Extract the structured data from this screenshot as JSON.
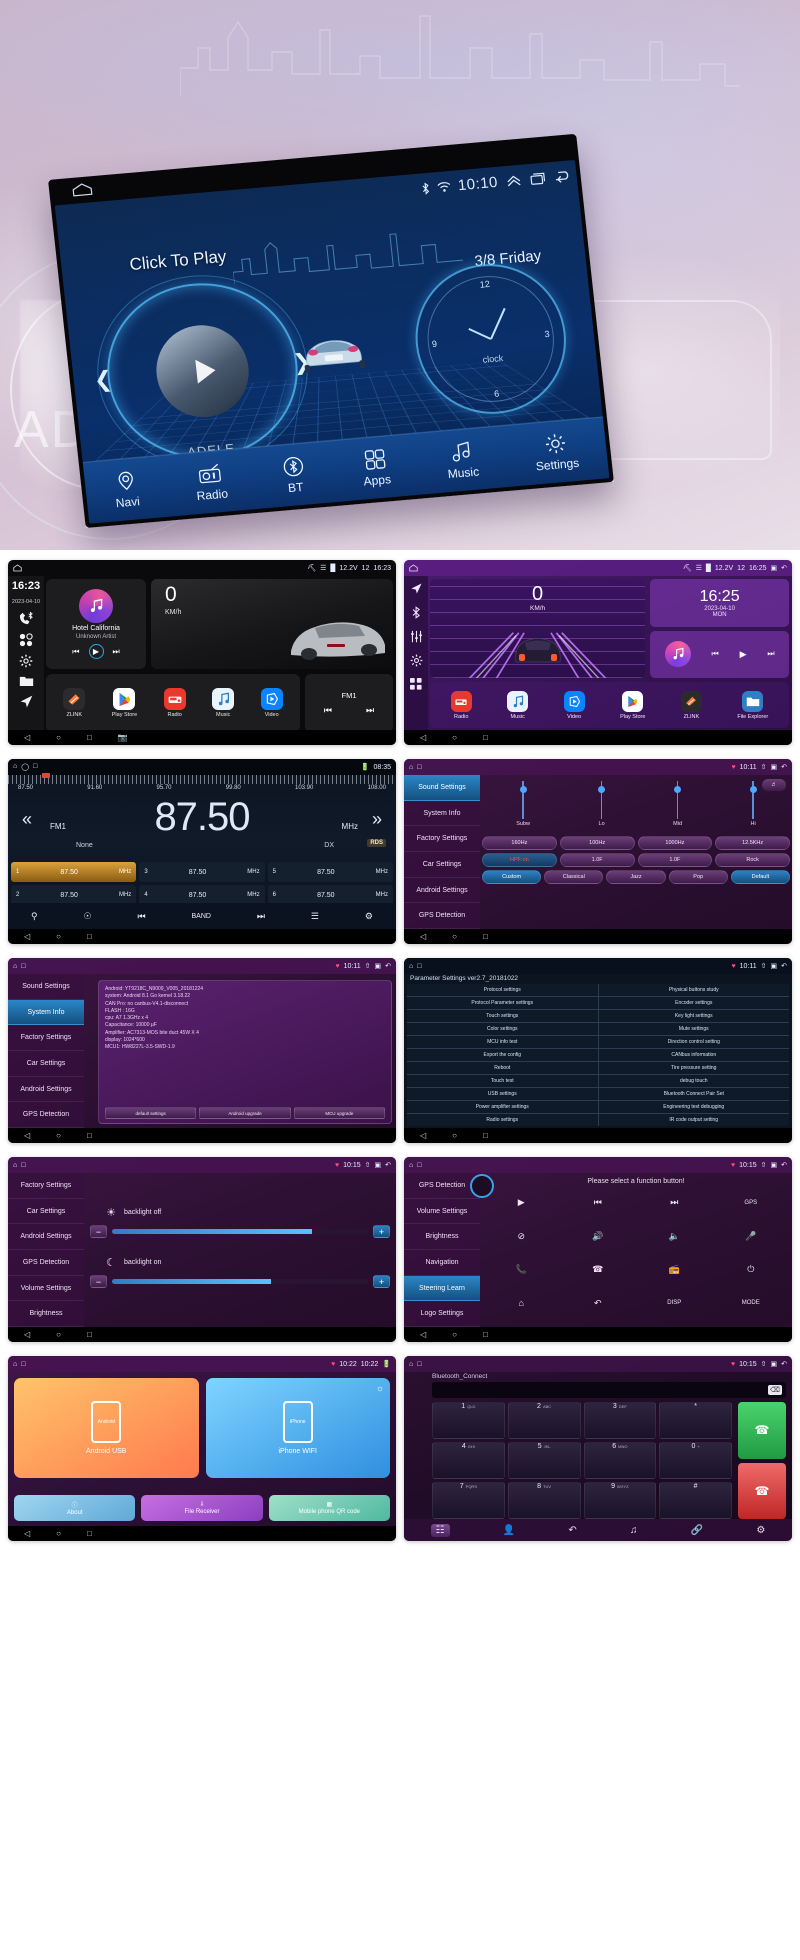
{
  "hero": {
    "status": {
      "time": "10:10",
      "bluetooth_icon": "bluetooth-icon",
      "wifi_icon": "wifi-icon"
    },
    "click_to_play": "Click To Play",
    "date": "3/8 Friday",
    "album_label": "ADELE",
    "clock_word": "clock",
    "clock_numbers": [
      "12",
      "3",
      "6",
      "9"
    ],
    "nav": [
      {
        "label": "Navi",
        "icon": "location-pin-icon"
      },
      {
        "label": "Radio",
        "icon": "radio-icon"
      },
      {
        "label": "BT",
        "icon": "bluetooth-circle-icon"
      },
      {
        "label": "Apps",
        "icon": "apps-grid-icon"
      },
      {
        "label": "Music",
        "icon": "music-note-icon"
      },
      {
        "label": "Settings",
        "icon": "gear-icon"
      }
    ]
  },
  "shot1": {
    "name": "black-home-screen",
    "status": {
      "home_icon": "home-icon",
      "bluetooth": "bluetooth-icon",
      "wifi": "wifi-icon",
      "signal": "signal-icon",
      "battery_volt": "12.2V",
      "volume": "12",
      "time": "16:23"
    },
    "sidebar": {
      "time": "16:23",
      "date": "2023-04-10",
      "icons": [
        "bluetooth-phone-icon",
        "apps-grid-icon",
        "gear-icon",
        "folder-icon",
        "navigation-arrow-icon"
      ]
    },
    "music": {
      "title": "Hotel California",
      "artist": "Unknown Artist",
      "prev": "prev-icon",
      "play": "play-icon",
      "next": "next-icon"
    },
    "speed": {
      "value": "0",
      "unit": "KM/h"
    },
    "apps": [
      {
        "label": "ZLINK",
        "icon": "zlink-icon",
        "color": "#2b2b2e"
      },
      {
        "label": "Play Store",
        "icon": "play-store-icon",
        "color": "#ffffff"
      },
      {
        "label": "Radio",
        "icon": "radio-icon",
        "color": "#e8392c"
      },
      {
        "label": "Music",
        "icon": "music-note-icon",
        "color": "#eaf4ff"
      },
      {
        "label": "Video",
        "icon": "video-icon",
        "color": "#0a84ff"
      }
    ],
    "fm": {
      "label": "FM1",
      "prev": "prev-icon",
      "next": "next-icon"
    },
    "navbar": [
      "back-icon",
      "home-icon",
      "recents-icon",
      "screenshot-icon"
    ]
  },
  "shot2": {
    "name": "purple-home-screen",
    "status": {
      "home_icon": "home-icon",
      "bluetooth": "bluetooth-icon",
      "wifi": "wifi-icon",
      "signal": "signal-icon",
      "battery_volt": "12.2V",
      "volume": "12",
      "time": "16:25"
    },
    "sidebar": [
      "navigation-arrow-icon",
      "bluetooth-icon",
      "equalizer-icon",
      "gear-icon",
      "apps-grid-icon"
    ],
    "speed": {
      "value": "0",
      "unit": "KM/h"
    },
    "clock": {
      "time": "16:25",
      "date": "2023-04-10",
      "day": "MON"
    },
    "music_controls": {
      "prev": "prev-icon",
      "play": "play-icon",
      "next": "next-icon"
    },
    "apps": [
      {
        "label": "Radio",
        "icon": "radio-icon",
        "color": "#e8392c"
      },
      {
        "label": "Music",
        "icon": "music-note-icon",
        "color": "#eaf4ff"
      },
      {
        "label": "Video",
        "icon": "video-icon",
        "color": "#0a84ff"
      },
      {
        "label": "Play Store",
        "icon": "play-store-icon",
        "color": "#ffffff"
      },
      {
        "label": "ZLINK",
        "icon": "zlink-icon",
        "color": "#2b2b2e"
      },
      {
        "label": "File Explorer",
        "icon": "folder-icon",
        "color": "#2f7fc4"
      }
    ]
  },
  "shot3": {
    "name": "fm-radio-screen",
    "status": {
      "time": "08:35",
      "battery": "battery-icon"
    },
    "scale_ticks": [
      "87.50",
      "91.60",
      "95.70",
      "99.80",
      "103.90",
      "108.00"
    ],
    "frequency": "87.50",
    "band": "FM1",
    "unit": "MHz",
    "station_name": "None",
    "mode": "DX",
    "rds": "RDS",
    "prev_icon": "double-chevron-left-icon",
    "next_icon": "double-chevron-right-icon",
    "presets": [
      {
        "n": "1",
        "freq": "87.50",
        "unit": "MHz",
        "active": true
      },
      {
        "n": "3",
        "freq": "87.50",
        "unit": "MHz",
        "active": false
      },
      {
        "n": "5",
        "freq": "87.50",
        "unit": "MHz",
        "active": false
      },
      {
        "n": "2",
        "freq": "87.50",
        "unit": "MHz",
        "active": false
      },
      {
        "n": "4",
        "freq": "87.50",
        "unit": "MHz",
        "active": false
      },
      {
        "n": "6",
        "freq": "87.50",
        "unit": "MHz",
        "active": false
      }
    ],
    "bottom_icons": [
      "search-icon",
      "scan-icon",
      "prev-icon",
      "band-label",
      "next-icon",
      "equalizer-icon",
      "gear-icon"
    ],
    "band_label": "BAND"
  },
  "shot4": {
    "name": "sound-settings-screen",
    "status": {
      "time": "10:11"
    },
    "menu": [
      {
        "label": "Sound Settings",
        "selected": true
      },
      {
        "label": "System Info",
        "selected": false
      },
      {
        "label": "Factory Settings",
        "selected": false
      },
      {
        "label": "Car Settings",
        "selected": false
      },
      {
        "label": "Android Settings",
        "selected": false
      },
      {
        "label": "GPS Detection",
        "selected": false
      }
    ],
    "sliders": [
      {
        "label": "Subw",
        "pos": 12
      },
      {
        "label": "Lo",
        "pos": 12
      },
      {
        "label": "Mid",
        "pos": 12
      },
      {
        "label": "Hi",
        "pos": 12
      }
    ],
    "freq_row": [
      "160Hz",
      "100Hz",
      "1000Hz",
      "12.5KHz"
    ],
    "gain_row": [
      "HPF:on",
      "1.0F",
      "1.0F",
      "Rock"
    ],
    "preset_row": [
      "Custom",
      "Classical",
      "Jazz",
      "Pop",
      "Default"
    ],
    "eq_icon": "equalizer-icon"
  },
  "shot5": {
    "name": "system-info-screen",
    "status": {
      "time": "10:11"
    },
    "menu": [
      {
        "label": "Sound Settings",
        "selected": false
      },
      {
        "label": "System Info",
        "selected": true
      },
      {
        "label": "Factory Settings",
        "selected": false
      },
      {
        "label": "Car Settings",
        "selected": false
      },
      {
        "label": "Android Settings",
        "selected": false
      },
      {
        "label": "GPS Detection",
        "selected": false
      }
    ],
    "lines": [
      "Android: YT9218C_N9009_V005_20181224",
      "system: Android 8.1 Go   kernel 3.18.22",
      "CAN Pro:  no canbus-V4.1-disconnect",
      "FLASH : 16G",
      "cpu: A7 1.3GHz x 4",
      "Capacitance: 10000 µF",
      "Amplifier:  AC7313-MOS bite duct 45W X 4",
      "display:  1024*600",
      "MCU1: HW8227L-3.5-SWD-1.9"
    ],
    "buttons": [
      "default settings",
      "Android upgrade",
      "MCU upgrade"
    ]
  },
  "shot6": {
    "name": "parameter-settings-screen",
    "title": "Parameter Settings ver2.7_20181022",
    "status": {
      "time": "10:11"
    },
    "cells": [
      "Protocol settings",
      "Physical buttons study",
      "Protocol Parameter settings",
      "Encoder settings",
      "Touch settings",
      "Key light settings",
      "Color settings",
      "Mute settings",
      "MCU info test",
      "Direction control setting",
      "Export the config",
      "CANbus information",
      "Reboot",
      "Tire pressure setting",
      "Touch test",
      "debug touch",
      "USB settings",
      "Bluetooth Connect Pair Set",
      "Power amplifier settings",
      "Engineering test debugging",
      "Radio settings",
      "IR code output setting"
    ]
  },
  "shot7": {
    "name": "backlight-settings-screen",
    "status": {
      "time": "10:15"
    },
    "menu": [
      {
        "label": "Factory Settings",
        "selected": false
      },
      {
        "label": "Car Settings",
        "selected": false
      },
      {
        "label": "Android Settings",
        "selected": false
      },
      {
        "label": "GPS Detection",
        "selected": false
      },
      {
        "label": "Volume Settings",
        "selected": false
      },
      {
        "label": "Brightness",
        "selected": true
      }
    ],
    "rows": [
      {
        "icon": "sun-icon",
        "label": "backlight off",
        "minus": "−",
        "plus": "+",
        "fill": 78
      },
      {
        "icon": "moon-icon",
        "label": "backlight on",
        "minus": "−",
        "plus": "+",
        "fill": 62
      }
    ]
  },
  "shot8": {
    "name": "steering-wheel-learn-screen",
    "status": {
      "time": "10:15"
    },
    "menu": [
      {
        "label": "GPS Detection",
        "selected": false
      },
      {
        "label": "Volume Settings",
        "selected": false
      },
      {
        "label": "Brightness",
        "selected": false
      },
      {
        "label": "Navigation",
        "selected": false
      },
      {
        "label": "Steering Learn",
        "selected": true
      },
      {
        "label": "Logo Settings",
        "selected": false
      }
    ],
    "prompt": "Please select a function button!",
    "wheel_icon": "steering-wheel-icon",
    "buttons": [
      {
        "glyph": "▶",
        "label": "",
        "name": "play-button"
      },
      {
        "glyph": "⏮",
        "label": "",
        "name": "prev-button"
      },
      {
        "glyph": "⏭",
        "label": "",
        "name": "next-button"
      },
      {
        "glyph": "",
        "label": "GPS",
        "name": "gps-button"
      },
      {
        "glyph": "🚫",
        "label": "",
        "name": "mute-button"
      },
      {
        "glyph": "🔊",
        "label": "",
        "name": "volume-up-button"
      },
      {
        "glyph": "🔉",
        "label": "",
        "name": "volume-down-button"
      },
      {
        "glyph": "🎤",
        "label": "",
        "name": "voice-button"
      },
      {
        "glyph": "📞",
        "label": "",
        "name": "answer-button"
      },
      {
        "glyph": "📵",
        "label": "",
        "name": "hangup-button"
      },
      {
        "glyph": "📻",
        "label": "",
        "name": "radio-button"
      },
      {
        "glyph": "⏻",
        "label": "",
        "name": "power-button"
      },
      {
        "glyph": "⌂",
        "label": "",
        "name": "home-button"
      },
      {
        "glyph": "↩",
        "label": "",
        "name": "back-button"
      },
      {
        "glyph": "",
        "label": "DISP",
        "name": "disp-button"
      },
      {
        "glyph": "",
        "label": "MODE",
        "name": "mode-button"
      }
    ]
  },
  "shot9": {
    "name": "zlink-phone-connect-screen",
    "status": {
      "time": "10:22",
      "time2": "10:22",
      "battery": "battery-icon"
    },
    "cards": [
      {
        "label": "Android USB",
        "phone_text": "Android",
        "color": "#ff8a4d"
      },
      {
        "label": "iPhone WIFI",
        "phone_text": "iPhone",
        "color": "#3f9ee0"
      }
    ],
    "buttons": [
      {
        "label": "About",
        "icon": "info-icon"
      },
      {
        "label": "File Receiver",
        "icon": "download-icon"
      },
      {
        "label": "Mobile phone QR code",
        "icon": "qr-code-icon"
      }
    ]
  },
  "shot10": {
    "name": "bluetooth-dialpad-screen",
    "title": "Bluetooth_Connect",
    "status": {
      "time": "10:15"
    },
    "input_value": "",
    "delete_icon": "backspace-icon",
    "keys": [
      {
        "d": "1",
        "s": "QLD"
      },
      {
        "d": "2",
        "s": "ABC"
      },
      {
        "d": "3",
        "s": "DEF"
      },
      {
        "d": "*",
        "s": ""
      },
      {
        "d": "4",
        "s": "GHI"
      },
      {
        "d": "5",
        "s": "JKL"
      },
      {
        "d": "6",
        "s": "MNO"
      },
      {
        "d": "0",
        "s": "+"
      },
      {
        "d": "7",
        "s": "PQRS"
      },
      {
        "d": "8",
        "s": "TUV"
      },
      {
        "d": "9",
        "s": "WXYZ"
      },
      {
        "d": "#",
        "s": ""
      }
    ],
    "call_button": "answer-call-icon",
    "hangup_button": "end-call-icon",
    "dock": [
      "dialpad-icon",
      "contacts-icon",
      "call-history-icon",
      "music-icon",
      "link-icon",
      "gear-icon"
    ]
  },
  "colors": {
    "accent_blue": "#2f7fc4",
    "purple_bg": "#3b1540",
    "hero_blue": "#0b2f68",
    "orange": "#ff8a4d",
    "green": "#1f9b44",
    "red": "#c02626"
  }
}
